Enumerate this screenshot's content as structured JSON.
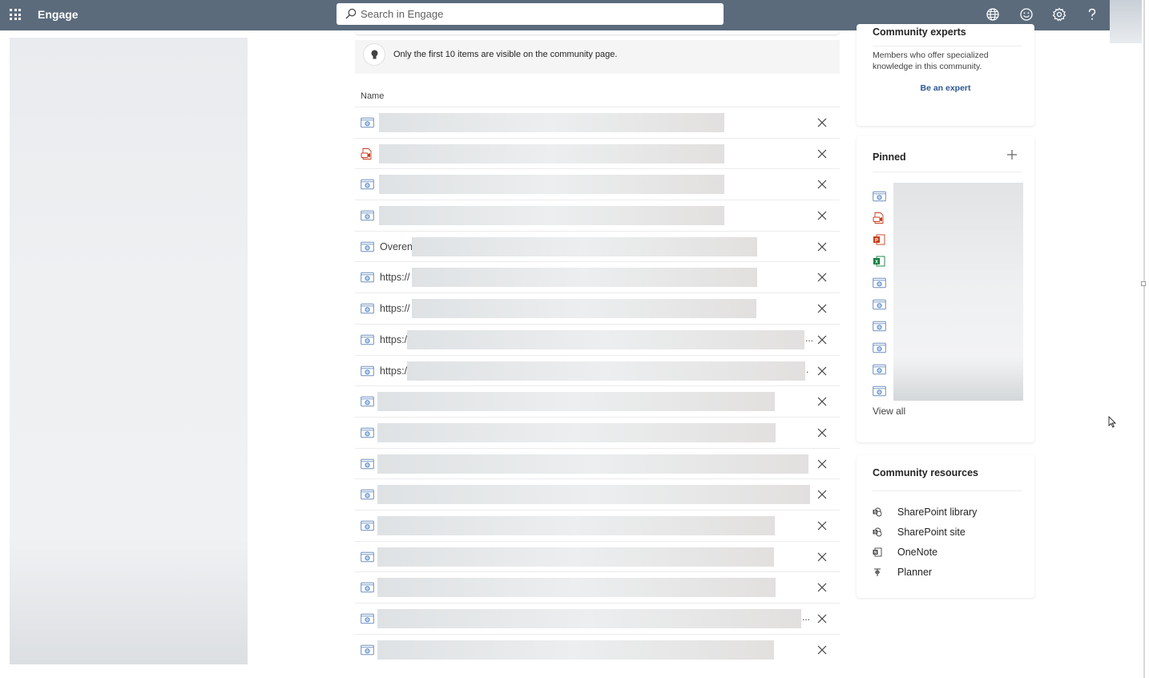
{
  "topbar": {
    "app_title": "Engage",
    "search_placeholder": "Search in Engage",
    "icons": [
      "globe-icon",
      "smiley-icon",
      "settings-icon",
      "help-icon"
    ]
  },
  "notice": {
    "text": "Only the first 10 items are visible on the community page."
  },
  "files": {
    "column_name": "Name",
    "rows": [
      {
        "icon": "link-file-icon",
        "prefix": ""
      },
      {
        "icon": "video-file-icon",
        "prefix": ""
      },
      {
        "icon": "link-file-icon",
        "prefix": ""
      },
      {
        "icon": "link-file-icon",
        "prefix": ""
      },
      {
        "icon": "link-file-icon",
        "prefix": "Overen"
      },
      {
        "icon": "link-file-icon",
        "prefix": "https://"
      },
      {
        "icon": "link-file-icon",
        "prefix": "https://"
      },
      {
        "icon": "link-file-icon",
        "prefix": "https:/",
        "suffix": "..."
      },
      {
        "icon": "link-file-icon",
        "prefix": "https:/",
        "suffix": "."
      },
      {
        "icon": "link-file-icon",
        "prefix": ""
      },
      {
        "icon": "link-file-icon",
        "prefix": ""
      },
      {
        "icon": "link-file-icon",
        "prefix": ""
      },
      {
        "icon": "link-file-icon",
        "prefix": ""
      },
      {
        "icon": "link-file-icon",
        "prefix": ""
      },
      {
        "icon": "link-file-icon",
        "prefix": ""
      },
      {
        "icon": "link-file-icon",
        "prefix": ""
      },
      {
        "icon": "link-file-icon",
        "prefix": "",
        "suffix": "..."
      },
      {
        "icon": "link-file-icon",
        "prefix": ""
      }
    ]
  },
  "experts": {
    "title": "Community experts",
    "description": "Members who offer specialized knowledge in this community.",
    "cta": "Be an expert"
  },
  "pinned": {
    "title": "Pinned",
    "icons": [
      "link-file-icon",
      "video-file-icon",
      "powerpoint-icon",
      "excel-icon",
      "link-file-icon",
      "link-file-icon",
      "link-file-icon",
      "link-file-icon",
      "link-file-icon",
      "link-file-icon"
    ],
    "view_all": "View all"
  },
  "resources": {
    "title": "Community resources",
    "items": [
      {
        "label": "SharePoint library",
        "icon": "sharepoint-icon"
      },
      {
        "label": "SharePoint site",
        "icon": "sharepoint-icon"
      },
      {
        "label": "OneNote",
        "icon": "onenote-icon"
      },
      {
        "label": "Planner",
        "icon": "planner-icon"
      }
    ]
  },
  "colors": {
    "topbar": "#5b6b7c",
    "link": "#2b579a",
    "file_icon_blue": "#4a7fc1",
    "video_red": "#c43e1c",
    "powerpoint": "#c43e1c",
    "excel": "#107c41"
  }
}
